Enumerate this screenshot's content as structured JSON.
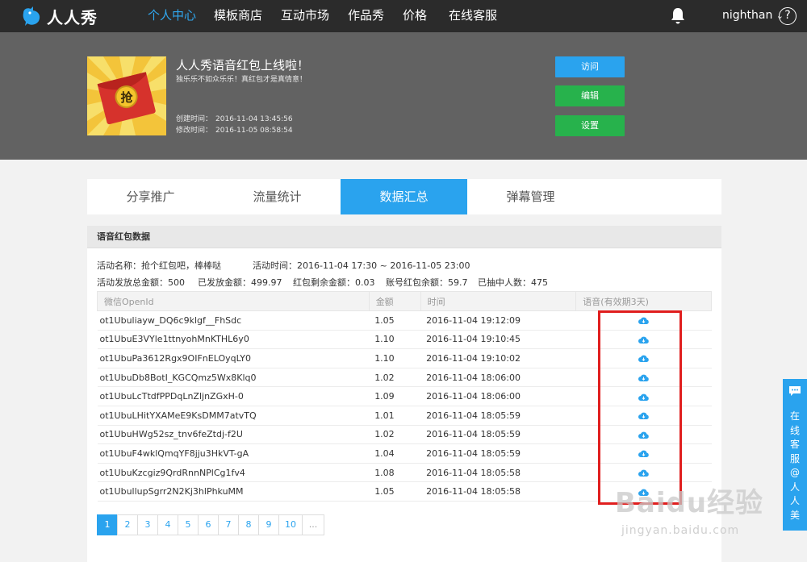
{
  "nav": {
    "brand": "人人秀",
    "items": [
      {
        "label": "个人中心",
        "active": true
      },
      {
        "label": "模板商店",
        "active": false
      },
      {
        "label": "互动市场",
        "active": false
      },
      {
        "label": "作品秀",
        "active": false
      },
      {
        "label": "价格",
        "active": false
      },
      {
        "label": "在线客服",
        "active": false
      }
    ],
    "user": "nighthan",
    "user_caret": "⌄",
    "help": "?"
  },
  "project": {
    "title": "人人秀语音红包上线啦！",
    "subtitle": "独乐乐不如众乐乐！真红包才是真情意！",
    "thumb_char": "抢",
    "created_label": "创建时间：",
    "created": "2016-11-04 13:45:56",
    "modified_label": "修改时间：",
    "modified": "2016-11-05 08:58:54",
    "buttons": {
      "visit": "访问",
      "edit": "编辑",
      "settings": "设置"
    }
  },
  "tabs": [
    {
      "label": "分享推广",
      "active": false
    },
    {
      "label": "流量统计",
      "active": false
    },
    {
      "label": "数据汇总",
      "active": true
    },
    {
      "label": "弹幕管理",
      "active": false
    }
  ],
  "panel": {
    "title": "语音红包数据",
    "activity_name_label": "活动名称：",
    "activity_name": "抢个红包吧，棒棒哒",
    "activity_time_label": "活动时间：",
    "activity_time": "2016-11-04 17:30 ~ 2016-11-05 23:00",
    "stats": [
      {
        "label": "活动发放总金额：",
        "value": "500"
      },
      {
        "label": "已发放金额：",
        "value": "499.97"
      },
      {
        "label": "红包剩余金额：",
        "value": "0.03"
      },
      {
        "label": "账号红包余额：",
        "value": "59.7"
      },
      {
        "label": "已抽中人数：",
        "value": "475"
      }
    ]
  },
  "table": {
    "headers": [
      "微信OpenId",
      "金额",
      "时间",
      "语音(有效期3天)"
    ],
    "rows": [
      {
        "openid": "ot1Ubuliayw_DQ6c9klgf__FhSdc",
        "amount": "1.05",
        "time": "2016-11-04 19:12:09"
      },
      {
        "openid": "ot1UbuE3VYle1ttnyohMnKTHL6y0",
        "amount": "1.10",
        "time": "2016-11-04 19:10:45"
      },
      {
        "openid": "ot1UbuPa3612Rgx9OIFnELOyqLY0",
        "amount": "1.10",
        "time": "2016-11-04 19:10:02"
      },
      {
        "openid": "ot1UbuDb8BotI_KGCQmz5Wx8Klq0",
        "amount": "1.02",
        "time": "2016-11-04 18:06:00"
      },
      {
        "openid": "ot1UbuLcTtdfPPDqLnZljnZGxH-0",
        "amount": "1.09",
        "time": "2016-11-04 18:06:00"
      },
      {
        "openid": "ot1UbuLHitYXAMeE9KsDMM7atvTQ",
        "amount": "1.01",
        "time": "2016-11-04 18:05:59"
      },
      {
        "openid": "ot1UbuHWg52sz_tnv6feZtdj-f2U",
        "amount": "1.02",
        "time": "2016-11-04 18:05:59"
      },
      {
        "openid": "ot1UbuF4wklQmqYF8jju3HkVT-gA",
        "amount": "1.04",
        "time": "2016-11-04 18:05:59"
      },
      {
        "openid": "ot1UbuKzcgiz9QrdRnnNPlCg1fv4",
        "amount": "1.08",
        "time": "2016-11-04 18:05:58"
      },
      {
        "openid": "ot1UbullupSgrr2N2Kj3hlPhkuMM",
        "amount": "1.05",
        "time": "2016-11-04 18:05:58"
      }
    ],
    "download_icon": "cloud-download-icon"
  },
  "pagination": {
    "pages": [
      "1",
      "2",
      "3",
      "4",
      "5",
      "6",
      "7",
      "8",
      "9",
      "10"
    ],
    "active": "1",
    "ellipsis": "..."
  },
  "side_service": {
    "text": "在线客服@人人美"
  },
  "watermark": {
    "main": "Baidu经验",
    "sub": "jingyan.baidu.com"
  },
  "colors": {
    "accent": "#2aa3ee",
    "success": "#27b24c",
    "highlight": "#e01e1e"
  }
}
